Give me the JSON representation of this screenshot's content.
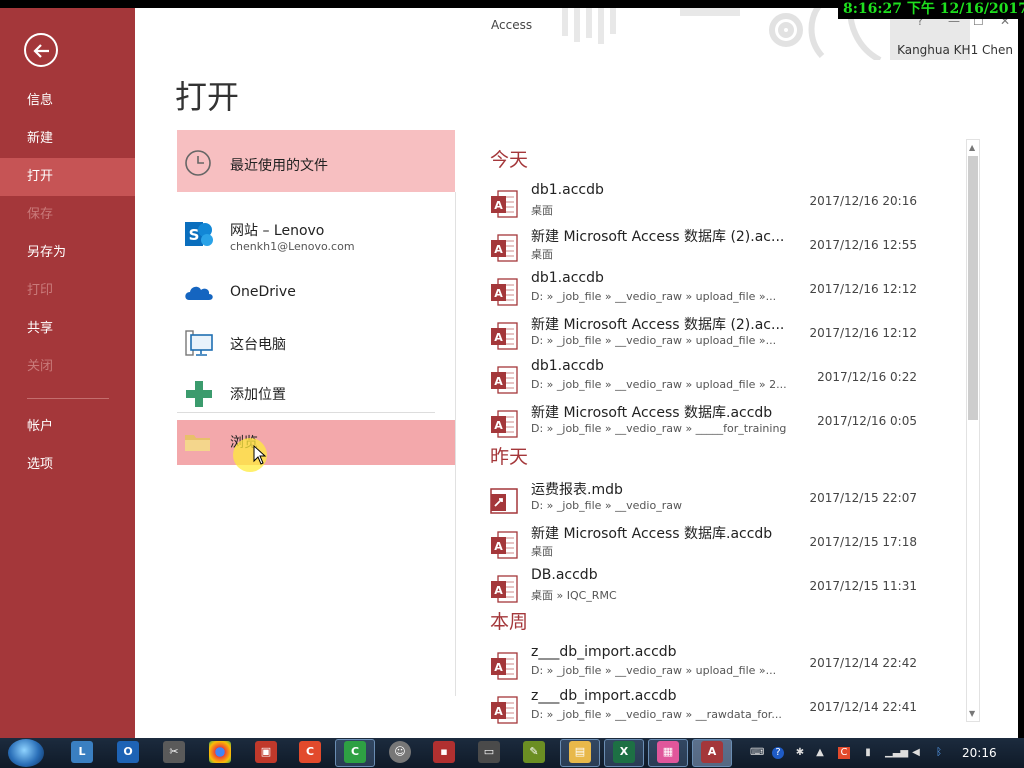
{
  "app": {
    "title": "Access",
    "user": "Kanghua KH1 Chen",
    "window_controls": [
      "?",
      "—",
      "☐",
      "✕"
    ]
  },
  "sidebar": {
    "items": [
      {
        "label": "信息"
      },
      {
        "label": "新建"
      },
      {
        "label": "打开"
      },
      {
        "label": "保存"
      },
      {
        "label": "另存为"
      },
      {
        "label": "打印"
      },
      {
        "label": "共享"
      },
      {
        "label": "关闭"
      },
      {
        "label": "帐户"
      },
      {
        "label": "选项"
      }
    ]
  },
  "page_title": "打开",
  "places": {
    "recent": {
      "label": "最近使用的文件"
    },
    "sharepoint": {
      "label": "网站 – Lenovo",
      "sub": "chenkh1@Lenovo.com"
    },
    "onedrive": {
      "label": "OneDrive"
    },
    "computer": {
      "label": "这台电脑"
    },
    "add": {
      "label": "添加位置"
    },
    "browse": {
      "label": "浏览"
    }
  },
  "groups": [
    {
      "label": "今天"
    },
    {
      "label": "昨天"
    },
    {
      "label": "本周"
    }
  ],
  "files": [
    {
      "name": "db1.accdb",
      "path": "桌面",
      "date": "2017/12/16 20:16"
    },
    {
      "name": "新建 Microsoft Access 数据库 (2).ac...",
      "path": "桌面",
      "date": "2017/12/16 12:55"
    },
    {
      "name": "db1.accdb",
      "path": "D: » _job_file » __vedio_raw » upload_file »...",
      "date": "2017/12/16 12:12"
    },
    {
      "name": "新建 Microsoft Access 数据库 (2).ac...",
      "path": "D: » _job_file » __vedio_raw » upload_file »...",
      "date": "2017/12/16 12:12"
    },
    {
      "name": "db1.accdb",
      "path": "D: » _job_file » __vedio_raw » upload_file » 2...",
      "date": "2017/12/16 0:22"
    },
    {
      "name": "新建 Microsoft Access 数据库.accdb",
      "path": "D: » _job_file » __vedio_raw » _____for_training",
      "date": "2017/12/16 0:05"
    },
    {
      "name": "运费报表.mdb",
      "path": "D: » _job_file » __vedio_raw",
      "date": "2017/12/15 22:07"
    },
    {
      "name": "新建 Microsoft Access 数据库.accdb",
      "path": "桌面",
      "date": "2017/12/15 17:18"
    },
    {
      "name": "DB.accdb",
      "path": "桌面 » IQC_RMC",
      "date": "2017/12/15 11:31"
    },
    {
      "name": "z___db_import.accdb",
      "path": "D: » _job_file » __vedio_raw » upload_file »...",
      "date": "2017/12/14 22:42"
    },
    {
      "name": "z___db_import.accdb",
      "path": "D: » _job_file » __vedio_raw » __rawdata_for...",
      "date": "2017/12/14 22:41"
    }
  ],
  "overlay_clock": "8:16:27 下午 12/16/2017 □",
  "taskbar": {
    "time": "20:16"
  },
  "colors": {
    "accent": "#a4373a",
    "sidebar_active": "#c65455",
    "recent_highlight": "#f7bfc1",
    "browse_highlight": "#f3a8ab"
  }
}
